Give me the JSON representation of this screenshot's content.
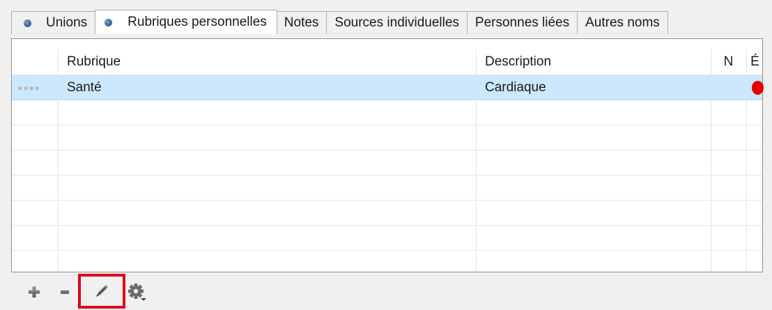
{
  "tabs": [
    {
      "label": "Unions",
      "has_dot": true,
      "active": false
    },
    {
      "label": "Rubriques personnelles",
      "has_dot": true,
      "active": true
    },
    {
      "label": "Notes",
      "has_dot": false,
      "active": false
    },
    {
      "label": "Sources individuelles",
      "has_dot": false,
      "active": false
    },
    {
      "label": "Personnes liées",
      "has_dot": false,
      "active": false
    },
    {
      "label": "Autres noms",
      "has_dot": false,
      "active": false
    }
  ],
  "grid": {
    "columns": {
      "rubrique": "Rubrique",
      "description": "Description",
      "n": "N",
      "e": "É"
    },
    "rows": [
      {
        "rubrique": "Santé",
        "description": "Cardiaque",
        "n": "",
        "e_status": "red-dot",
        "handle": "▪▪▪▪",
        "selected": true
      }
    ]
  },
  "toolbar": {
    "add": {
      "icon": "plus-icon"
    },
    "remove": {
      "icon": "minus-icon"
    },
    "edit": {
      "icon": "pencil-icon",
      "highlighted": true
    },
    "settings": {
      "icon": "gear-dropdown-icon"
    }
  },
  "colors": {
    "selection": "#cce8ff",
    "status_red": "#e60000",
    "highlight_red": "#e0001a",
    "tab_dot_blue": "#3d6aa6"
  }
}
